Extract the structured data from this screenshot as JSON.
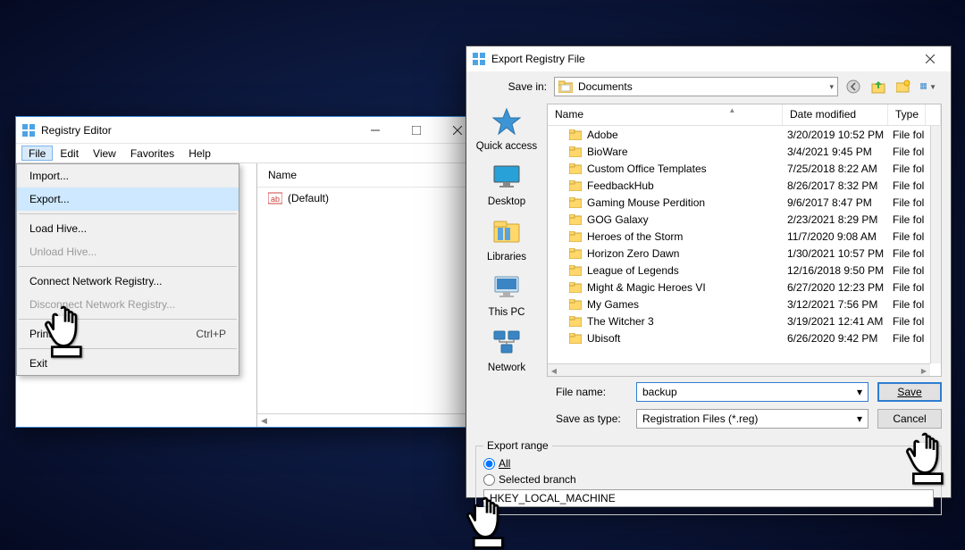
{
  "regedit": {
    "title": "Registry Editor",
    "menubar": [
      "File",
      "Edit",
      "View",
      "Favorites",
      "Help"
    ],
    "file_menu": {
      "import": "Import...",
      "export": "Export...",
      "load_hive": "Load Hive...",
      "unload_hive": "Unload Hive...",
      "connect": "Connect Network Registry...",
      "disconnect": "Disconnect Network Registry...",
      "print": "Print...",
      "print_shortcut": "Ctrl+P",
      "exit": "Exit"
    },
    "list": {
      "header_name": "Name",
      "default_value": "(Default)"
    }
  },
  "dlg": {
    "title": "Export Registry File",
    "savein_label": "Save in:",
    "savein_value": "Documents",
    "columns": {
      "name": "Name",
      "date": "Date modified",
      "type": "Type"
    },
    "places": {
      "quick": "Quick access",
      "desktop": "Desktop",
      "libraries": "Libraries",
      "thispc": "This PC",
      "network": "Network"
    },
    "rows": [
      {
        "name": "Adobe",
        "date": "3/20/2019 10:52 PM",
        "type": "File fol"
      },
      {
        "name": "BioWare",
        "date": "3/4/2021 9:45 PM",
        "type": "File fol"
      },
      {
        "name": "Custom Office Templates",
        "date": "7/25/2018 8:22 AM",
        "type": "File fol"
      },
      {
        "name": "FeedbackHub",
        "date": "8/26/2017 8:32 PM",
        "type": "File fol"
      },
      {
        "name": "Gaming Mouse Perdition",
        "date": "9/6/2017 8:47 PM",
        "type": "File fol"
      },
      {
        "name": "GOG Galaxy",
        "date": "2/23/2021 8:29 PM",
        "type": "File fol"
      },
      {
        "name": "Heroes of the Storm",
        "date": "11/7/2020 9:08 AM",
        "type": "File fol"
      },
      {
        "name": "Horizon Zero Dawn",
        "date": "1/30/2021 10:57 PM",
        "type": "File fol"
      },
      {
        "name": "League of Legends",
        "date": "12/16/2018 9:50 PM",
        "type": "File fol"
      },
      {
        "name": "Might & Magic Heroes VI",
        "date": "6/27/2020 12:23 PM",
        "type": "File fol"
      },
      {
        "name": "My Games",
        "date": "3/12/2021 7:56 PM",
        "type": "File fol"
      },
      {
        "name": "The Witcher 3",
        "date": "3/19/2021 12:41 AM",
        "type": "File fol"
      },
      {
        "name": "Ubisoft",
        "date": "6/26/2020 9:42 PM",
        "type": "File fol"
      }
    ],
    "file_name_label": "File name:",
    "file_name_value": "backup",
    "save_type_label": "Save as type:",
    "save_type_value": "Registration Files (*.reg)",
    "save_btn": "Save",
    "cancel_btn": "Cancel",
    "export_range": {
      "legend": "Export range",
      "all": "All",
      "selected": "Selected branch",
      "branch_value": "HKEY_LOCAL_MACHINE"
    }
  }
}
